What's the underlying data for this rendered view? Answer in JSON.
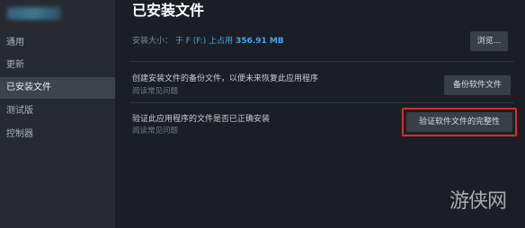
{
  "sidebar": {
    "items": [
      {
        "label": "通用"
      },
      {
        "label": "更新"
      },
      {
        "label": "已安装文件"
      },
      {
        "label": "测试版"
      },
      {
        "label": "控制器"
      }
    ]
  },
  "main": {
    "title": "已安装文件",
    "install_size_label": "安装大小：",
    "install_size_location": "于 F (F:) 上占用",
    "install_size_value": "356.91 MB",
    "browse_button": "浏览...",
    "backup": {
      "text": "创建安装文件的备份文件，以便未来恢复此应用程序",
      "faq": "阅读常见问题",
      "button": "备份软件文件"
    },
    "verify": {
      "text": "验证此应用程序的文件是否已正确安装",
      "faq": "阅读常见问题",
      "button": "验证软件文件的完整性"
    }
  },
  "watermark": "游侠网"
}
